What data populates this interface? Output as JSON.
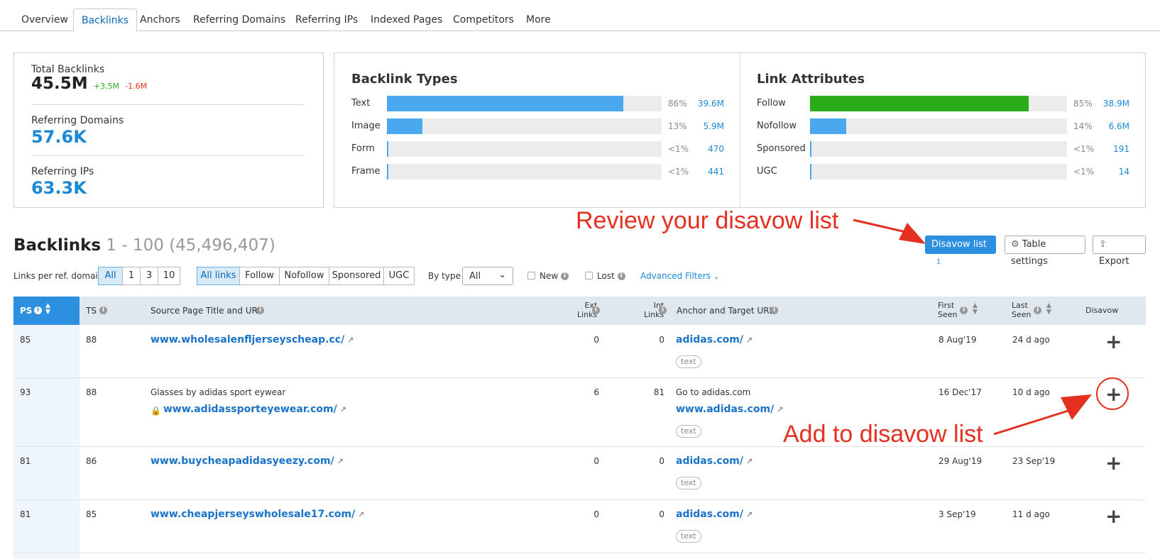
{
  "tabs": [
    "Overview",
    "Backlinks",
    "Anchors",
    "Referring Domains",
    "Referring IPs",
    "Indexed Pages",
    "Competitors",
    "More"
  ],
  "summary": {
    "total_label": "Total Backlinks",
    "total_value": "45.5M",
    "total_up": "+3.5M",
    "total_down": "-1.6M",
    "domains_label": "Referring Domains",
    "domains_value": "57.6K",
    "ips_label": "Referring IPs",
    "ips_value": "63.3K"
  },
  "backlink_types": {
    "title": "Backlink Types",
    "rows": [
      {
        "label": "Text",
        "pct": "86%",
        "count": "39.6M",
        "fill": 0.86
      },
      {
        "label": "Image",
        "pct": "13%",
        "count": "5.9M",
        "fill": 0.13
      },
      {
        "label": "Form",
        "pct": "<1%",
        "count": "470",
        "fill": 0.005
      },
      {
        "label": "Frame",
        "pct": "<1%",
        "count": "441",
        "fill": 0.005
      }
    ]
  },
  "link_attributes": {
    "title": "Link Attributes",
    "rows": [
      {
        "label": "Follow",
        "pct": "85%",
        "count": "38.9M",
        "fill": 0.85
      },
      {
        "label": "Nofollow",
        "pct": "14%",
        "count": "6.6M",
        "fill": 0.14
      },
      {
        "label": "Sponsored",
        "pct": "<1%",
        "count": "191",
        "fill": 0.005
      },
      {
        "label": "UGC",
        "pct": "<1%",
        "count": "14",
        "fill": 0.005
      }
    ]
  },
  "colors": {
    "types_bar": "#4aa8ee",
    "follow_bar": "#2aab1a",
    "nofollow_bar": "#4aa8ee",
    "accent": "#1a8ad6",
    "annotation": "#e53021"
  },
  "annotations": {
    "review": "Review your disavow list",
    "add": "Add to disavow list"
  },
  "heading": {
    "title": "Backlinks",
    "range": "1 - 100 (45,496,407)"
  },
  "toolbar": {
    "disavow_label": "Disavow list",
    "disavow_count": "1",
    "table_settings": "Table settings",
    "export": "Export"
  },
  "filters": {
    "per_domain_label": "Links per ref. domain",
    "per_domain_options": [
      "All",
      "1",
      "3",
      "10"
    ],
    "link_options": [
      "All links",
      "Follow",
      "Nofollow",
      "Sponsored",
      "UGC"
    ],
    "by_type_label": "By type",
    "by_type_value": "All",
    "new_label": "New",
    "lost_label": "Lost",
    "advanced": "Advanced Filters"
  },
  "table": {
    "headers": {
      "ps": "PS",
      "ts": "TS",
      "source": "Source Page Title and URL",
      "ext1": "Ext",
      "ext2": "Links",
      "int1": "Int",
      "int2": "Links",
      "anchor": "Anchor and Target URL",
      "first1": "First",
      "first2": "Seen",
      "last1": "Last",
      "last2": "Seen",
      "disavow": "Disavow"
    },
    "rows": [
      {
        "ps": "85",
        "ts": "88",
        "title": "",
        "url": "www.wholesalenfljerseyscheap.cc/",
        "ext": "0",
        "int": "0",
        "anchor_text": "",
        "target": "adidas.com/",
        "tag": "text",
        "first": "8 Aug'19",
        "last": "24 d ago"
      },
      {
        "ps": "93",
        "ts": "88",
        "title": "Glasses by adidas sport eywear",
        "url": "www.adidassporteyewear.com/",
        "ext": "6",
        "int": "81",
        "anchor_text": "Go to adidas.com",
        "target": "www.adidas.com/",
        "tag": "text",
        "first": "16 Dec'17",
        "last": "10 d ago"
      },
      {
        "ps": "81",
        "ts": "86",
        "title": "",
        "url": "www.buycheapadidasyeezy.com/",
        "ext": "0",
        "int": "0",
        "anchor_text": "",
        "target": "adidas.com/",
        "tag": "text",
        "first": "29 Aug'19",
        "last": "23 Sep'19"
      },
      {
        "ps": "81",
        "ts": "85",
        "title": "",
        "url": "www.cheapjerseyswholesale17.com/",
        "ext": "0",
        "int": "0",
        "anchor_text": "",
        "target": "adidas.com/",
        "tag": "text",
        "first": "3 Sep'19",
        "last": "11 d ago"
      }
    ]
  }
}
